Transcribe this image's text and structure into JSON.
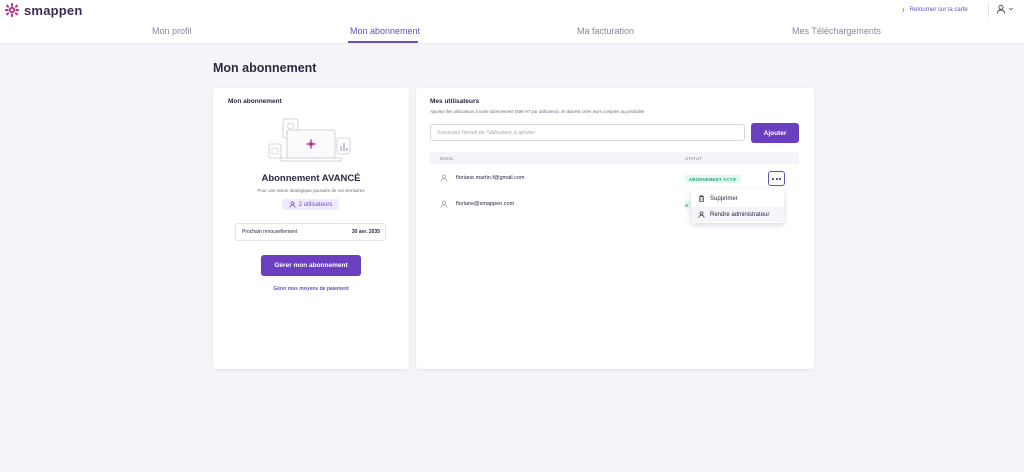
{
  "app": {
    "name": "smappen"
  },
  "header": {
    "back_link": "Retourner sur la carte",
    "chevron": "›"
  },
  "tabs": [
    {
      "label": "Mon profil"
    },
    {
      "label": "Mon abonnement"
    },
    {
      "label": "Ma facturation"
    },
    {
      "label": "Mes Téléchargements"
    }
  ],
  "page_title": "Mon abonnement",
  "subscription": {
    "card_title": "Mon abonnement",
    "plan_name": "Abonnement AVANCÉ",
    "description": "Pour une vision stratégique poussée de vos territoires",
    "users_badge": "2 utilisateurs",
    "renewal_label": "Prochain renouvellement",
    "renewal_date": "30 avr. 2035",
    "manage_button": "Gérer mon abonnement",
    "payment_link": "Gérer mes moyens de paiement"
  },
  "users": {
    "card_title": "Mes utilisateurs",
    "subtitle": "Ajoutez des utilisateurs à votre abonnement (50€ HT par utilisateur). Ils doivent créer leurs comptes au préalable",
    "input_placeholder": "Saisissez l'email de l'utilisateur à ajouter",
    "input_value": "",
    "add_button": "Ajouter",
    "columns": {
      "email": "EMAIL",
      "status": "STATUT"
    },
    "rows": [
      {
        "email": "floriane.martin.f@gmail.com",
        "status": "ABONNEMENT ACTIF"
      },
      {
        "email": "floriane@smappen.com",
        "status": "A"
      }
    ],
    "menu": {
      "delete": "Supprimer",
      "make_admin": "Rendre administrateur"
    }
  },
  "colors": {
    "accent": "#6b3fc0",
    "active_status": "#2aa37a",
    "logo": "#b5338a"
  }
}
